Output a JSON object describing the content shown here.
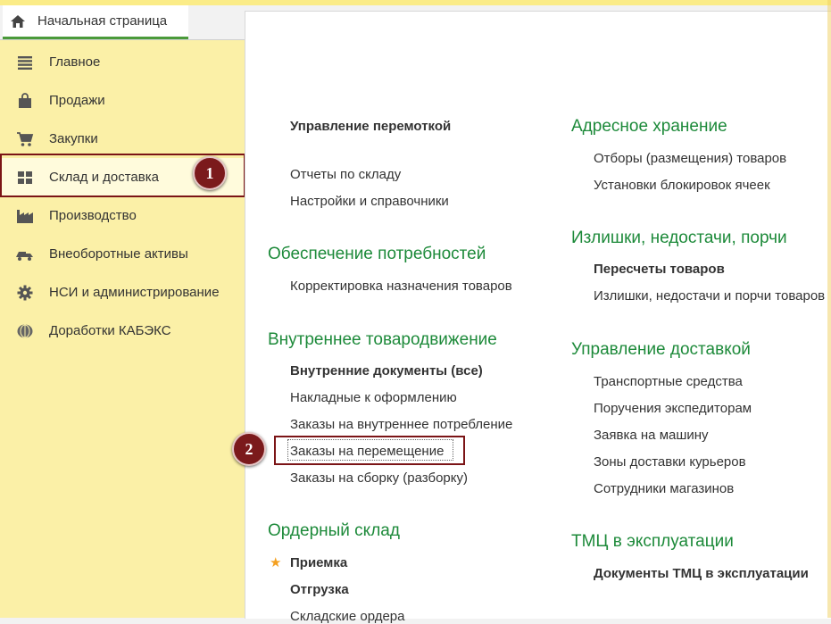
{
  "tabs": {
    "home_label": "Начальная страница"
  },
  "sidebar": {
    "items": [
      {
        "label": "Главное",
        "icon": "menu-lines-icon"
      },
      {
        "label": "Продажи",
        "icon": "shopping-bag-icon"
      },
      {
        "label": "Закупки",
        "icon": "shopping-cart-icon"
      },
      {
        "label": "Склад и доставка",
        "icon": "warehouse-grid-icon"
      },
      {
        "label": "Производство",
        "icon": "factory-icon"
      },
      {
        "label": "Внеоборотные активы",
        "icon": "truck-icon"
      },
      {
        "label": "НСИ и администрирование",
        "icon": "gear-icon"
      },
      {
        "label": "Доработки КАБЭКС",
        "icon": "extension-icon"
      }
    ]
  },
  "badges": {
    "first": "1",
    "second": "2"
  },
  "left_column": {
    "top_link": "Управление перемоткой",
    "misc_links": [
      "Отчеты по складу",
      "Настройки и справочники"
    ],
    "groups": [
      {
        "title": "Обеспечение потребностей",
        "links": [
          "Корректировка назначения товаров"
        ]
      },
      {
        "title": "Внутреннее товародвижение",
        "links": [
          "Внутренние документы (все)",
          "Накладные к оформлению",
          "Заказы на внутреннее потребление",
          "Заказы на перемещение",
          "Заказы на сборку (разборку)"
        ]
      },
      {
        "title": "Ордерный склад",
        "links": [
          "Приемка",
          "Отгрузка",
          "Складские ордера"
        ]
      }
    ]
  },
  "right_column": {
    "groups": [
      {
        "title": "Адресное хранение",
        "links": [
          "Отборы (размещения) товаров",
          "Установки блокировок ячеек"
        ]
      },
      {
        "title": "Излишки, недостачи, порчи",
        "links": [
          "Пересчеты товаров",
          "Излишки, недостачи и порчи товаров"
        ]
      },
      {
        "title": "Управление доставкой",
        "links": [
          "Транспортные средства",
          "Поручения экспедиторам",
          "Заявка на машину",
          "Зоны доставки курьеров",
          "Сотрудники магазинов"
        ]
      },
      {
        "title": "ТМЦ в эксплуатации",
        "links": [
          "Документы ТМЦ в эксплуатации"
        ]
      }
    ]
  },
  "colors": {
    "sidebar_bg": "#fbf0a7",
    "group_title": "#1d8a3a",
    "highlight_border": "#7b1416",
    "badge": "#7b1a1c"
  }
}
